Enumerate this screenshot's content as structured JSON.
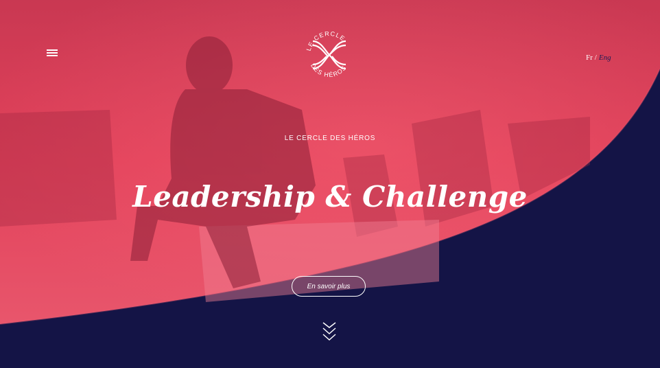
{
  "header": {
    "menu_icon": "hamburger-icon",
    "logo": {
      "icon": "cercle-des-heros-logo",
      "text_top": "LE CERCLE",
      "text_bottom": "DES HÉROS"
    },
    "language": {
      "fr": "Fr",
      "separator": "/",
      "eng": "Eng"
    }
  },
  "hero": {
    "eyebrow": "LE CERCLE DES HÉROS",
    "headline": "Leadership & Challenge",
    "cta_label": "En savoir plus",
    "scroll_icon": "double-chevron-down-icon"
  },
  "colors": {
    "accent_red": "#e2415a",
    "navy": "#141446",
    "white": "#ffffff"
  }
}
